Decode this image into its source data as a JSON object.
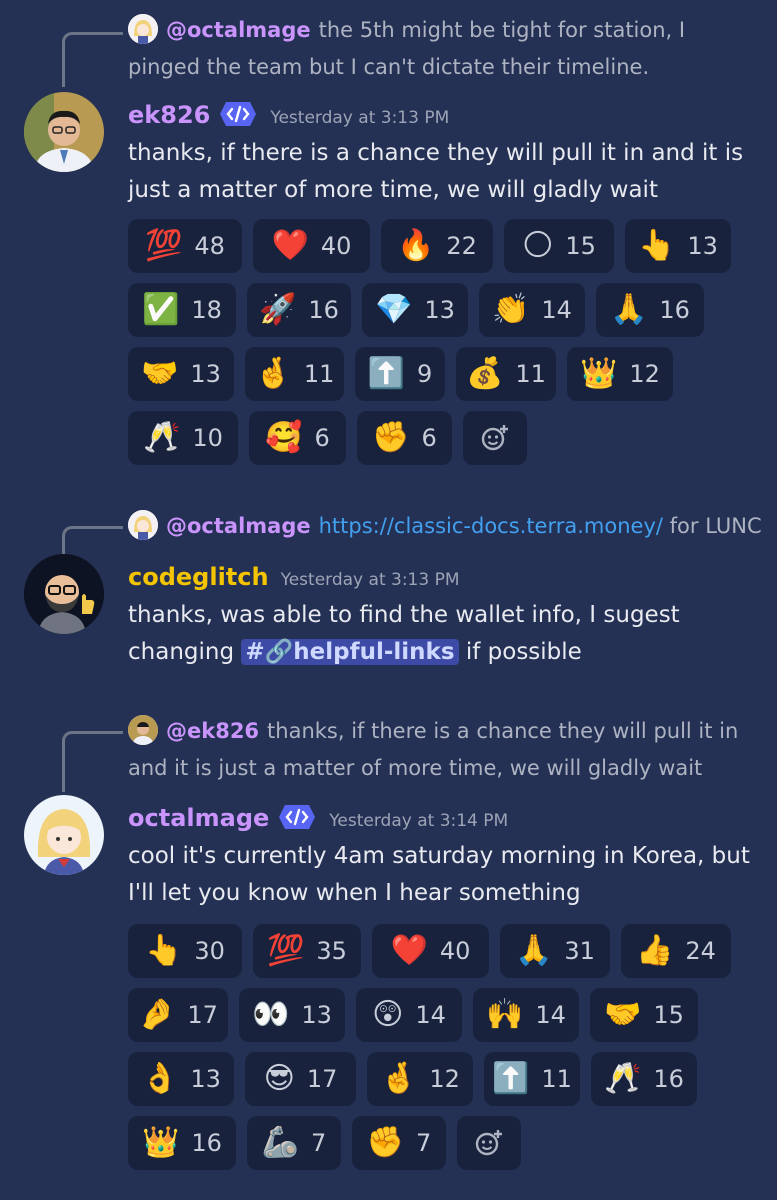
{
  "messages": [
    {
      "reply": {
        "mention": "@octalmage",
        "text": "the 5th might be tight for station, I pinged the team but I can't dictate their timeline."
      },
      "author": "ek826",
      "author_color": "#c994fc",
      "dev_badge": true,
      "timestamp": "Yesterday at 3:13 PM",
      "text": "thanks, if there is a chance they will pull it in and it is just a matter of more time, we will gladly wait",
      "reactions": [
        [
          {
            "emoji": "💯",
            "count": "48"
          },
          {
            "emoji": "❤️",
            "count": "40"
          },
          {
            "emoji": "🔥",
            "count": "22"
          },
          {
            "emoji": "🌕",
            "count": "15"
          },
          {
            "emoji": "👆",
            "count": "13"
          }
        ],
        [
          {
            "emoji": "✅",
            "count": "18"
          },
          {
            "emoji": "🚀",
            "count": "16"
          },
          {
            "emoji": "💎",
            "count": "13"
          },
          {
            "emoji": "👏",
            "count": "14"
          },
          {
            "emoji": "🙏",
            "count": "16"
          }
        ],
        [
          {
            "emoji": "🤝",
            "count": "13"
          },
          {
            "emoji": "🤞",
            "count": "11"
          },
          {
            "emoji": "⬆️",
            "count": "9"
          },
          {
            "emoji": "💰",
            "count": "11"
          },
          {
            "emoji": "👑",
            "count": "12"
          }
        ],
        [
          {
            "emoji": "🥂",
            "count": "10"
          },
          {
            "emoji": "🥰",
            "count": "6"
          },
          {
            "emoji": "✊",
            "count": "6"
          }
        ]
      ]
    },
    {
      "reply": {
        "mention": "@octalmage",
        "link": "https://classic-docs.terra.money/",
        "text": "for LUNC"
      },
      "author": "codeglitch",
      "author_color": "#f5c400",
      "timestamp": "Yesterday at 3:13 PM",
      "text_part1": "thanks, was able to find the wallet info, I sugest changing",
      "channel": "#🔗helpful-links",
      "text_part2": "if possible"
    },
    {
      "reply": {
        "mention": "@ek826",
        "text": "thanks, if there is a chance they will pull it in and it is just a matter of more time, we will gladly wait"
      },
      "author": "octalmage",
      "author_color": "#c994fc",
      "dev_badge": true,
      "timestamp": "Yesterday at 3:14 PM",
      "text": "cool it's currently 4am saturday morning in Korea, but I'll let you know when I hear something",
      "reactions": [
        [
          {
            "emoji": "👆",
            "count": "30"
          },
          {
            "emoji": "💯",
            "count": "35"
          },
          {
            "emoji": "❤️",
            "count": "40"
          },
          {
            "emoji": "🙏",
            "count": "31"
          },
          {
            "emoji": "👍",
            "count": "24"
          }
        ],
        [
          {
            "emoji": "🤌",
            "count": "17"
          },
          {
            "emoji": "👀",
            "count": "13"
          },
          {
            "emoji": "😲",
            "count": "14"
          },
          {
            "emoji": "🙌",
            "count": "14"
          },
          {
            "emoji": "🤝",
            "count": "15"
          }
        ],
        [
          {
            "emoji": "👌",
            "count": "13"
          },
          {
            "emoji": "😎",
            "count": "17"
          },
          {
            "emoji": "🤞",
            "count": "12"
          },
          {
            "emoji": "⬆️",
            "count": "11"
          },
          {
            "emoji": "🥂",
            "count": "16"
          }
        ],
        [
          {
            "emoji": "👑",
            "count": "16"
          },
          {
            "emoji": "🦾",
            "count": "7"
          },
          {
            "emoji": "✊",
            "count": "7"
          }
        ]
      ]
    }
  ],
  "icons": {
    "add_reaction": "add-reaction-icon",
    "dev_badge": "developer-badge-icon"
  },
  "colors": {
    "background": "#243154",
    "chip": "#18223c",
    "mention": "#c994fc",
    "link": "#42a0ef",
    "channel_bg": "#3d4aa6"
  }
}
